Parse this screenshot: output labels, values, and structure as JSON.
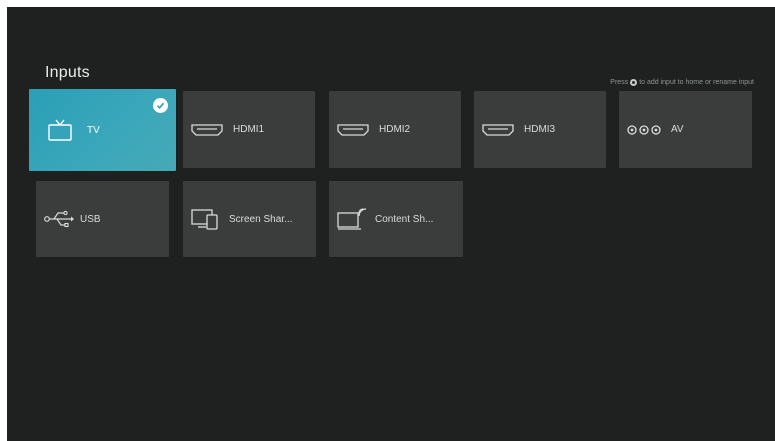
{
  "page": {
    "title": "Inputs"
  },
  "hint": {
    "prefix": "Press",
    "suffix": "to add input to home or rename input"
  },
  "inputs": [
    {
      "label": "TV",
      "icon": "tv-icon",
      "selected": true
    },
    {
      "label": "HDMI1",
      "icon": "hdmi-port-icon"
    },
    {
      "label": "HDMI2",
      "icon": "hdmi-port-icon"
    },
    {
      "label": "HDMI3",
      "icon": "hdmi-port-icon"
    },
    {
      "label": "AV",
      "icon": "av-rca-icon"
    },
    {
      "label": "USB",
      "icon": "usb-icon"
    },
    {
      "label": "Screen Shar...",
      "icon": "screen-share-icon"
    },
    {
      "label": "Content Sh...",
      "icon": "content-share-icon"
    }
  ],
  "colors": {
    "background": "#1e211f",
    "tile": "#3a3d3b",
    "selected_tile": "#36a4b9",
    "text": "#d8dcda"
  }
}
